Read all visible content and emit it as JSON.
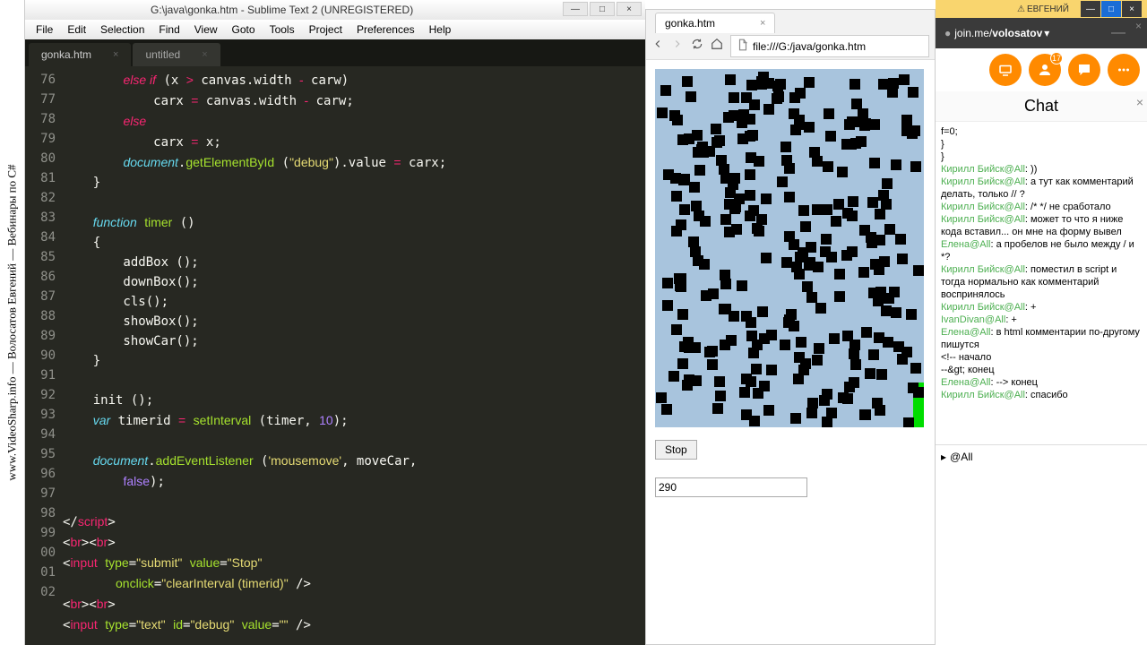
{
  "sidebar": {
    "text": "www.VideoSharp.info — Волосатов Евгений — Вебинары по C#"
  },
  "sublime": {
    "title": "G:\\java\\gonka.htm - Sublime Text 2 (UNREGISTERED)",
    "menu": [
      "File",
      "Edit",
      "Selection",
      "Find",
      "View",
      "Goto",
      "Tools",
      "Project",
      "Preferences",
      "Help"
    ],
    "tabs": [
      {
        "label": "gonka.htm",
        "close": "×"
      },
      {
        "label": "untitled",
        "close": "×"
      }
    ],
    "lines": [
      "76",
      "77",
      "78",
      "79",
      "80",
      "81",
      "82",
      "83",
      "84",
      "85",
      "86",
      "87",
      "88",
      "89",
      "90",
      "91",
      "92",
      "93",
      "94",
      "95",
      "96",
      "97",
      "98",
      "99",
      "00",
      "01",
      "02"
    ]
  },
  "browser": {
    "tab": "gonka.htm",
    "tab_close": "×",
    "url": "file:///G:/java/gonka.htm",
    "stop_label": "Stop",
    "debug_value": "290"
  },
  "joinme": {
    "warning": "ЕВГЕНИЙ",
    "brand": "join.me/",
    "user": "volosatov",
    "chat_title": "Chat",
    "badge_count": "17",
    "chat_footer": "@All",
    "messages": [
      {
        "raw": "    f=0;"
      },
      {
        "raw": "  }"
      },
      {
        "raw": "}"
      },
      {
        "user": "Кирилл Бийск@All",
        "text": ": ))"
      },
      {
        "user": "Кирилл Бийск@All",
        "text": ": а тут как комментарий делать, только // ?"
      },
      {
        "user": "Кирилл Бийск@All",
        "text": ": /* */ не сработало"
      },
      {
        "user": "Кирилл Бийск@All",
        "text": ": может то что я ниже кода вставил... он мне на форму вывел"
      },
      {
        "user": "Елена@All",
        "text": ": а пробелов не было между / и *?"
      },
      {
        "user": "Кирилл Бийск@All",
        "text": ": поместил в script и тогда нормально как комментарий воспринялось"
      },
      {
        "user": "Кирилл Бийск@All",
        "text": ": +"
      },
      {
        "user": "IvanDivan@All",
        "text": ": +"
      },
      {
        "user": "Елена@All",
        "text": ": в html комментарии по-другому пишутся"
      },
      {
        "raw": "<!-- начало"
      },
      {
        "raw": "--&gt;   конец"
      },
      {
        "user": "Елена@All",
        "text": ": --> конец"
      },
      {
        "user": "Кирилл Бийск@All",
        "text": ": спасибо"
      }
    ]
  }
}
